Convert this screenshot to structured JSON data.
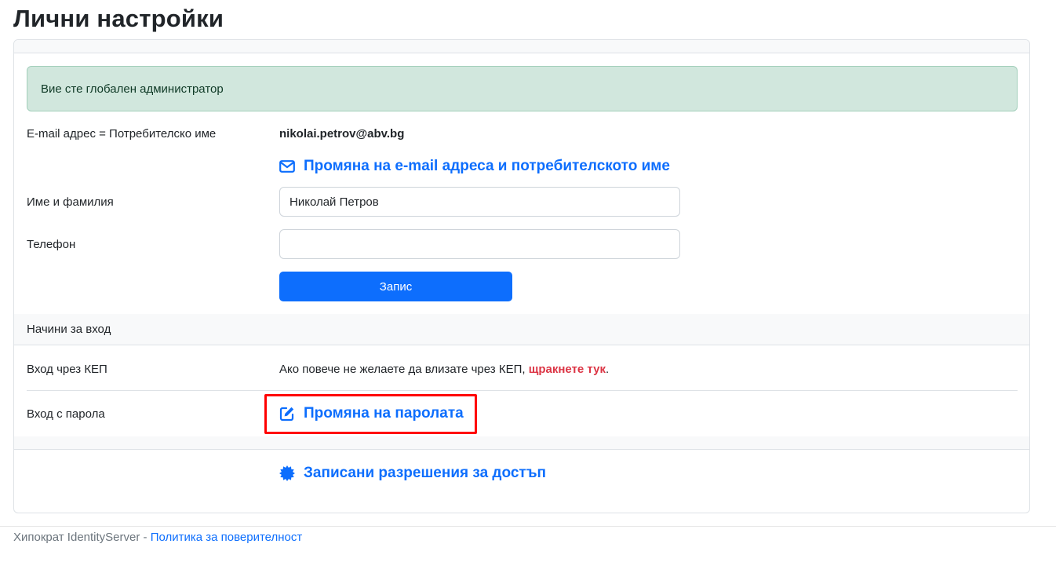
{
  "page": {
    "title": "Лични настройки"
  },
  "alert": {
    "text": "Вие сте глобален администратор"
  },
  "account": {
    "email_label": "E-mail адрес = Потребителско име",
    "email_value": "nikolai.petrov@abv.bg",
    "change_email_link": "Промяна на e-mail адреса и потребителското име",
    "name_label": "Име и фамилия",
    "name_value": "Николай Петров",
    "phone_label": "Телефон",
    "phone_value": "",
    "save_label": "Запис"
  },
  "login_methods": {
    "section_title": "Начини за вход",
    "kep_label": "Вход чрез КЕП",
    "kep_text": "Ако повече не желаете да влизате чрез КЕП, ",
    "kep_link": "щракнете тук",
    "kep_suffix": ".",
    "password_label": "Вход с парола",
    "change_password_link": "Промяна на паролата"
  },
  "permissions": {
    "link": "Записани разрешения за достъп"
  },
  "footer": {
    "text": "Хипократ IdentityServer - ",
    "privacy_link": "Политика за поверителност"
  },
  "colors": {
    "primary": "#0d6efd",
    "danger": "#dc3545",
    "success_bg": "#d1e7dd",
    "highlight": "#ff0000"
  },
  "icons": {
    "change_email": "envelope-icon",
    "change_password": "edit-icon",
    "permissions": "badge-icon"
  }
}
